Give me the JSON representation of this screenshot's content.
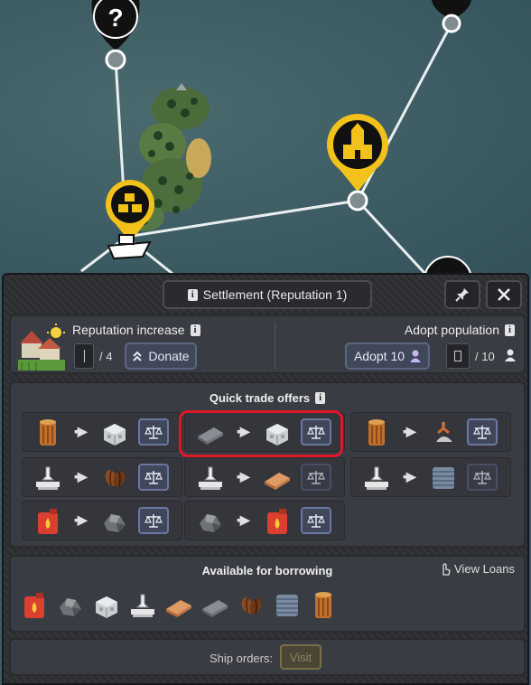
{
  "window": {
    "title": "Settlement (Reputation 1)"
  },
  "reputation": {
    "label": "Reputation increase",
    "current": "",
    "total": "/ 4",
    "donate_label": "Donate"
  },
  "population": {
    "label": "Adopt population",
    "adopt_label": "Adopt 10",
    "total": "/ 10"
  },
  "trade": {
    "title": "Quick trade offers",
    "offers": [
      {
        "give": "wood-log-icon",
        "get": "concrete-block-icon",
        "enabled": true
      },
      {
        "give": "iron-plate-icon",
        "get": "concrete-block-icon",
        "enabled": true,
        "highlighted": true
      },
      {
        "give": "wood-log-icon",
        "get": "crane-claw-ore-icon",
        "enabled": true
      },
      {
        "give": "food-ration-icon",
        "get": "coffee-beans-icon",
        "enabled": true
      },
      {
        "give": "food-ration-icon",
        "get": "wood-plank-icon",
        "enabled": false
      },
      {
        "give": "food-ration-icon",
        "get": "steel-coil-icon",
        "enabled": false
      },
      {
        "give": "fuel-canister-icon",
        "get": "rock-ore-icon",
        "enabled": true
      },
      {
        "give": "rock-ore-icon",
        "get": "fuel-canister-icon",
        "enabled": true
      }
    ]
  },
  "borrowing": {
    "title": "Available for borrowing",
    "view_loans_label": "View Loans",
    "items": [
      "fuel-canister-icon",
      "rock-ore-icon",
      "concrete-block-icon",
      "food-ration-icon",
      "wood-plank-icon",
      "iron-plate-icon",
      "coffee-beans-icon",
      "steel-coil-icon",
      "wood-log-icon"
    ]
  },
  "ship_orders": {
    "label": "Ship orders:",
    "visit_label": "Visit"
  },
  "map": {
    "markers": [
      "unknown-location-marker",
      "settlement-marker",
      "castle-marker"
    ],
    "question_mark": "?"
  },
  "colors": {
    "accent": "#f2c21a",
    "panel": "#2c2d31",
    "button": "#41475a",
    "highlight": "#e0182a"
  }
}
